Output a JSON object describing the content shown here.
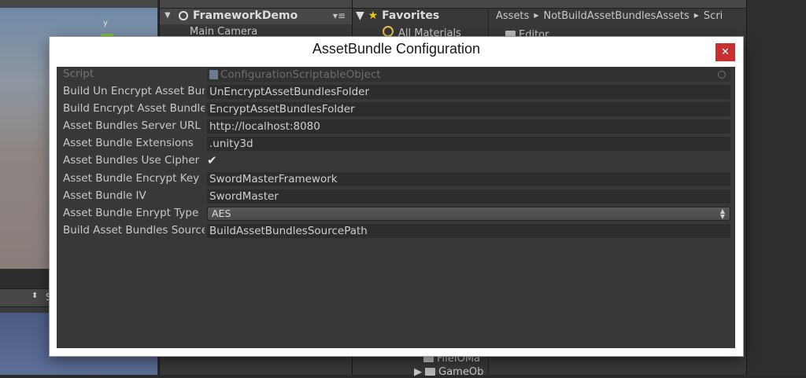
{
  "background": {
    "hierarchy": {
      "scene_name": "FrameworkDemo",
      "item": "Main Camera"
    },
    "project": {
      "favorites_label": "Favorites",
      "favorites_item": "All Materials",
      "breadcrumb": [
        "Assets",
        "NotBuildAssetBundlesAssets",
        "Scri"
      ],
      "folder_editor": "Editor",
      "file_1": "FileIOMa",
      "file_2": "GameOb"
    },
    "scene_gizmo_axis": "y",
    "scene_bottom_letter": "S"
  },
  "dialog": {
    "title": "AssetBundle Configuration",
    "close_symbol": "✕"
  },
  "inspector": {
    "script": {
      "label": "Script",
      "value": "ConfigurationScriptableObject"
    },
    "fields": [
      {
        "label": "Build Un Encrypt Asset Bundles Folder",
        "value": "UnEncryptAssetBundlesFolder"
      },
      {
        "label": "Build Encrypt Asset Bundles Folder",
        "value": "EncryptAssetBundlesFolder"
      },
      {
        "label": "Asset Bundles Server URL",
        "value": "http://localhost:8080"
      },
      {
        "label": "Asset Bundle Extensions",
        "value": ".unity3d"
      }
    ],
    "use_cipher": {
      "label": "Asset Bundles Use Cipher",
      "checked": true,
      "check_symbol": "✔"
    },
    "fields2": [
      {
        "label": "Asset Bundle Encrypt Key",
        "value": "SwordMasterFramework"
      },
      {
        "label": "Asset Bundle IV",
        "value": "SwordMaster"
      }
    ],
    "encrypt_type": {
      "label": "Asset Bundle Enrypt Type",
      "value": "AES"
    },
    "source_path": {
      "label": "Build Asset Bundles Source Path",
      "value": "BuildAssetBundlesSourcePath"
    }
  }
}
